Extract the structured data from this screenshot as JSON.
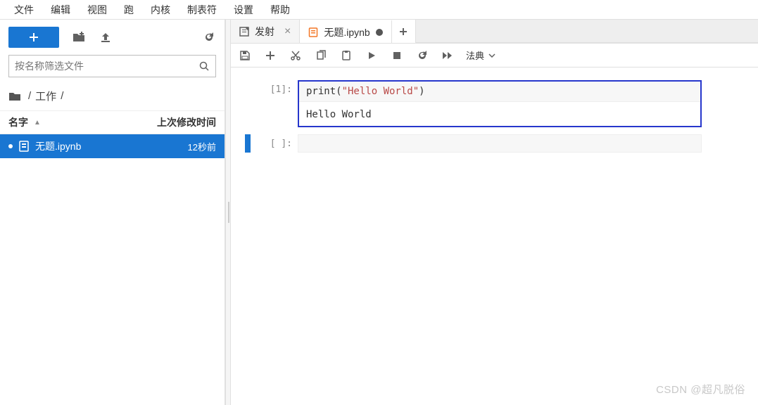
{
  "menu": [
    "文件",
    "编辑",
    "视图",
    "跑",
    "内核",
    "制表符",
    "设置",
    "帮助"
  ],
  "sidebar": {
    "filter_placeholder": "按名称筛选文件",
    "breadcrumb": [
      "/",
      "工作",
      "/"
    ],
    "header_name": "名字",
    "header_modified": "上次修改时间",
    "files": [
      {
        "name": "无题.ipynb",
        "modified": "12秒前",
        "selected": true
      }
    ]
  },
  "tabs": [
    {
      "label": "发射",
      "kind": "launcher",
      "active": false,
      "closable": true
    },
    {
      "label": "无题.ipynb",
      "kind": "notebook",
      "active": true,
      "dirty": true
    }
  ],
  "nb_toolbar": {
    "celltype": "法典"
  },
  "cells": [
    {
      "prompt": "[1]:",
      "code_prefix": "print(",
      "code_string": "\"Hello World\"",
      "code_suffix": ")",
      "output": "Hello World"
    },
    {
      "prompt": "[ ]:"
    }
  ],
  "watermark": "CSDN @超凡脱俗"
}
